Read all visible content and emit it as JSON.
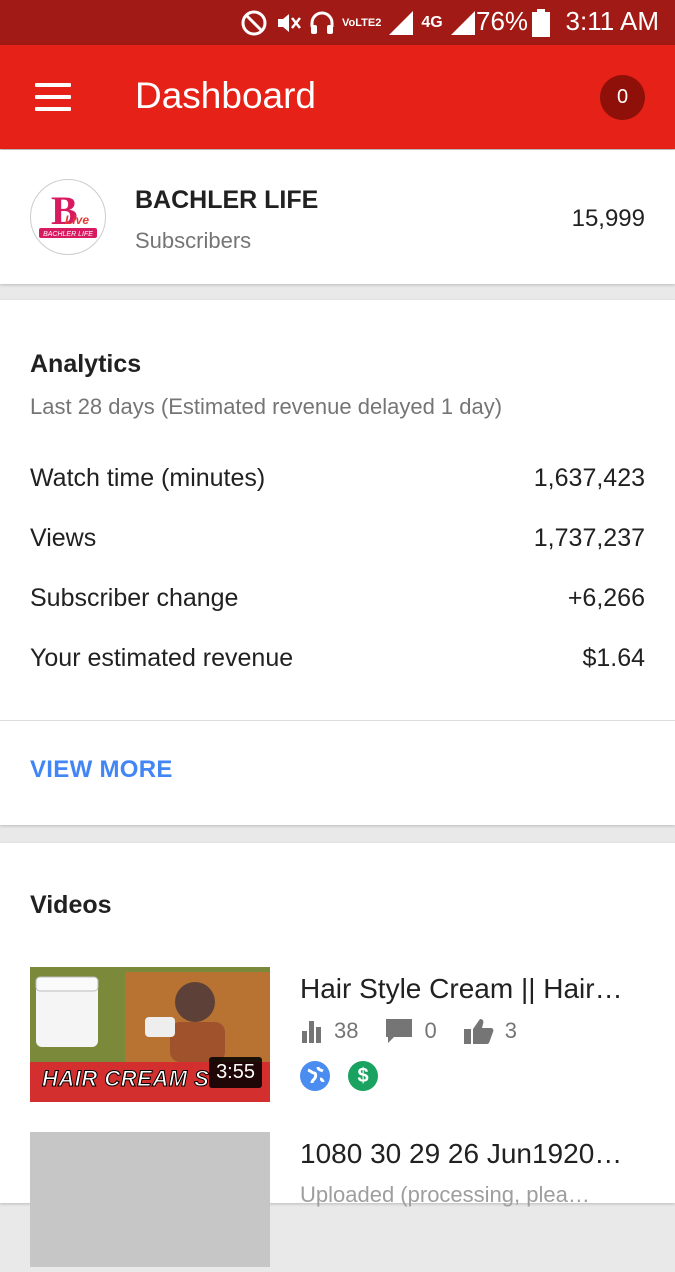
{
  "status_bar": {
    "volte": "VoLTE2",
    "network": "4G",
    "battery": "76%",
    "time": "3:11 AM"
  },
  "app_bar": {
    "title": "Dashboard",
    "notification_count": "0"
  },
  "channel": {
    "name": "BACHLER LIFE",
    "subscribers_label": "Subscribers",
    "subscribers_count": "15,999",
    "logo_text": "BACHLER LIFE"
  },
  "analytics": {
    "title": "Analytics",
    "subtitle": "Last 28 days (Estimated revenue delayed 1 day)",
    "metrics": [
      {
        "label": "Watch time (minutes)",
        "value": "1,637,423"
      },
      {
        "label": "Views",
        "value": "1,737,237"
      },
      {
        "label": "Subscriber change",
        "value": "+6,266"
      },
      {
        "label": "Your estimated revenue",
        "value": "$1.64"
      }
    ],
    "view_more": "VIEW MORE"
  },
  "videos": {
    "title": "Videos",
    "items": [
      {
        "title": "Hair Style Cream || Hair…",
        "thumb_caption": "HAIR CREAM S",
        "duration": "3:55",
        "views": "38",
        "comments": "0",
        "likes": "3"
      },
      {
        "title": "1080 30 29 26 Jun1920…",
        "status": "Uploaded (processing, plea…"
      }
    ]
  },
  "colors": {
    "app_bar": "#e62117",
    "status_bar": "#a11a15",
    "accent_link": "#4285f4"
  }
}
